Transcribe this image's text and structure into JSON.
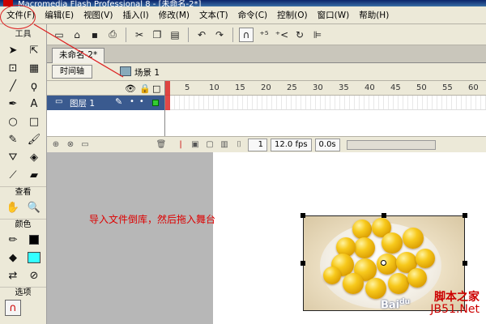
{
  "window": {
    "title": "Macromedia Flash Professional 8 - [未命名-2*]"
  },
  "menu": [
    "文件(F)",
    "编辑(E)",
    "视图(V)",
    "插入(I)",
    "修改(M)",
    "文本(T)",
    "命令(C)",
    "控制(O)",
    "窗口(W)",
    "帮助(H)"
  ],
  "toolbar": {
    "icons": [
      "new-doc-icon",
      "open-icon",
      "save-icon",
      "print-icon",
      "cut-icon",
      "copy-icon",
      "paste-icon",
      "undo-icon",
      "redo-icon",
      "snap-magnet-icon",
      "smooth-icon",
      "straighten-icon",
      "rotate-icon",
      "align-icon"
    ]
  },
  "tools": {
    "title": "工具",
    "view_label": "查看",
    "colors_label": "颜色",
    "options_label": "选项",
    "stroke_color": "#000000",
    "fill_color": "#33ffff"
  },
  "document": {
    "tab": "未命名-2*"
  },
  "timeline": {
    "toggle_label": "时间轴",
    "scene_label": "场景 1",
    "layer_name": "图层 1",
    "ruler_ticks": [
      "5",
      "10",
      "15",
      "20",
      "25",
      "30",
      "35",
      "40",
      "45",
      "50",
      "55",
      "60"
    ],
    "frame": "1",
    "fps": "12.0 fps",
    "time": "0.0s"
  },
  "stage": {
    "annotation": "导入文件倒库，然后拖入舞台",
    "image_caption": "Bai",
    "image_caption_sup": "du"
  },
  "watermark": {
    "line1": "脚本之家",
    "line2": "JB51.Net"
  },
  "colors": {
    "accent_red": "#dd0000",
    "layer_selected": "#3a5a8f"
  }
}
